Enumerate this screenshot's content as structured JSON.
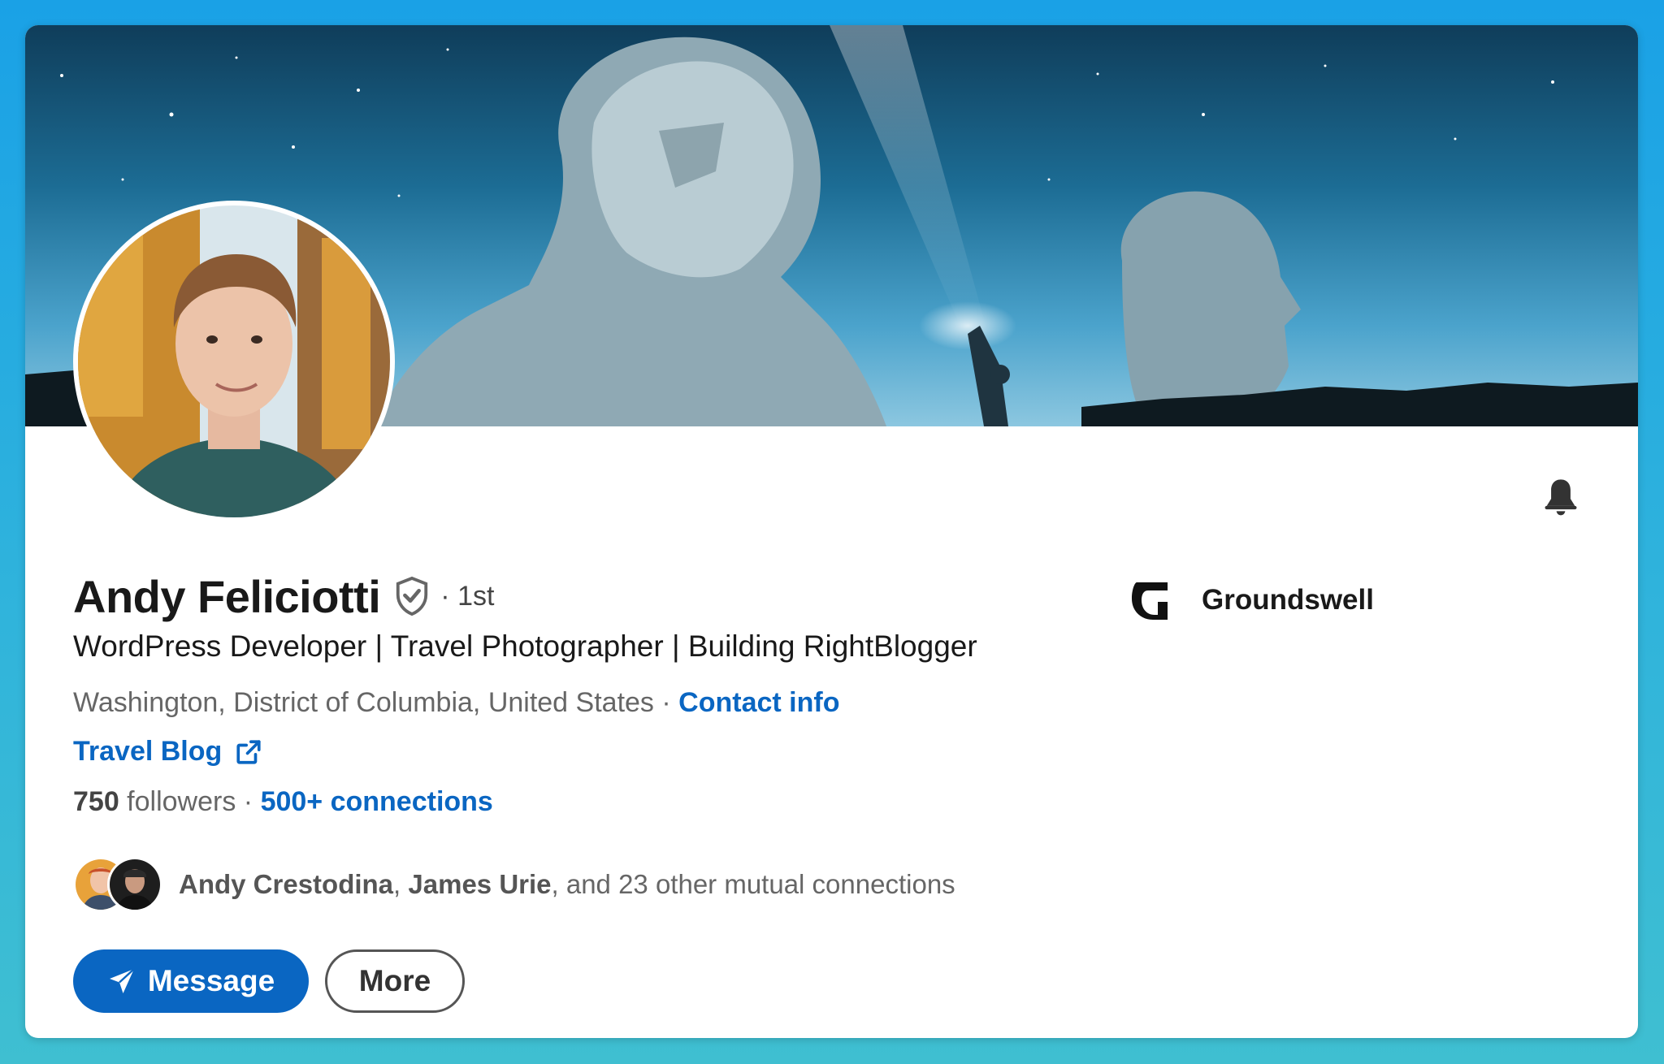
{
  "profile": {
    "name": "Andy Feliciotti",
    "degree": "· 1st",
    "headline": "WordPress Developer | Travel Photographer | Building RightBlogger",
    "location": "Washington, District of Columbia, United States",
    "location_separator": " · ",
    "contact_label": "Contact info",
    "website_label": "Travel Blog",
    "followers_count": "750",
    "followers_label": " followers",
    "stats_separator": "  · ",
    "connections_label": "500+ connections"
  },
  "mutual": {
    "first": "Andy Crestodina",
    "sep1": ", ",
    "second": "James Urie",
    "rest": ", and 23 other mutual connections"
  },
  "actions": {
    "message_label": "Message",
    "more_label": "More"
  },
  "company": {
    "name": "Groundswell"
  },
  "colors": {
    "accent": "#0a66c2",
    "background_top": "#1aa1e6",
    "background_bottom": "#3fbfd1"
  },
  "icons": {
    "verified": "shield-check-icon",
    "external": "external-link-icon",
    "bell": "bell-icon",
    "send": "paper-plane-icon"
  }
}
